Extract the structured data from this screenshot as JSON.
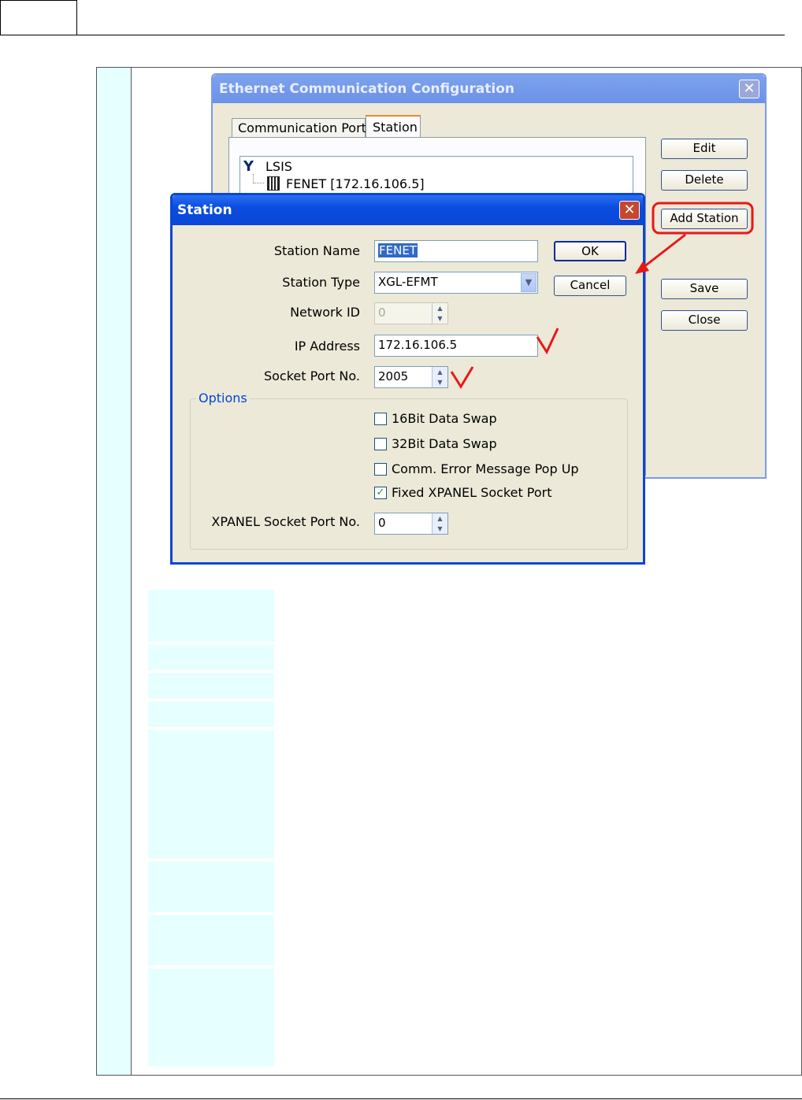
{
  "back_window": {
    "title": "Ethernet Communication Configuration",
    "tabs": [
      "Communication Port",
      "Station"
    ],
    "tree": {
      "root": "LSIS",
      "child": "FENET [172.16.106.5]"
    },
    "buttons": {
      "edit": "Edit",
      "delete": "Delete",
      "add_station": "Add Station",
      "save": "Save",
      "close": "Close"
    }
  },
  "station_dialog": {
    "title": "Station",
    "labels": {
      "station_name": "Station Name",
      "station_type": "Station Type",
      "network_id": "Network ID",
      "ip_address": "IP Address",
      "socket_port": "Socket Port No.",
      "xpanel_socket_port": "XPANEL Socket Port No."
    },
    "values": {
      "station_name": "FENET",
      "station_type": "XGL-EFMT",
      "network_id": "0",
      "ip_address": "172.16.106.5",
      "socket_port": "2005",
      "xpanel_socket_port": "0"
    },
    "buttons": {
      "ok": "OK",
      "cancel": "Cancel"
    },
    "options": {
      "legend": "Options",
      "items": [
        {
          "label": "16Bit Data Swap",
          "checked": false
        },
        {
          "label": "32Bit Data Swap",
          "checked": false
        },
        {
          "label": "Comm. Error Message Pop Up",
          "checked": false
        },
        {
          "label": "Fixed XPANEL Socket Port",
          "checked": true
        }
      ]
    }
  },
  "annotation_color": "#e81818",
  "colors": {
    "cyan_cell": "#e6ffff",
    "dialog_face": "#ece9d8",
    "xp_title_blue": "#0a4de0"
  }
}
